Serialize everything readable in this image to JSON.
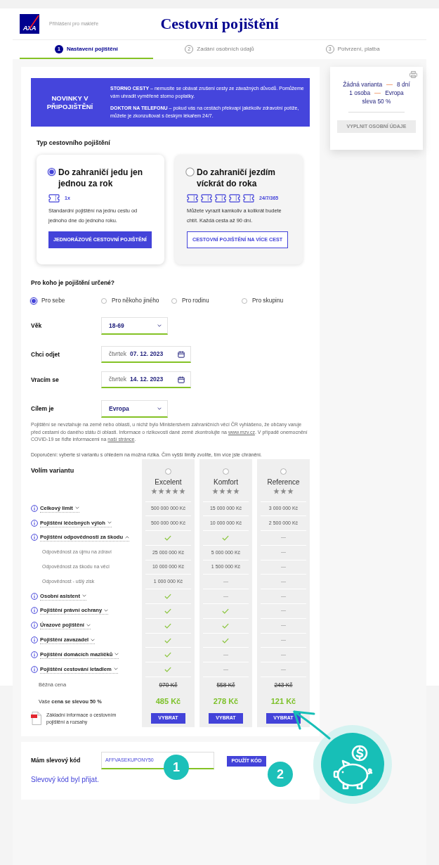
{
  "header": {
    "logo": "AXA",
    "broker_login": "Přihlášení pro makléře",
    "title": "Cestovní pojištění"
  },
  "steps": [
    {
      "number": "1",
      "label": "Nastavení pojištění",
      "selected": true
    },
    {
      "number": "2",
      "label": "Zadání osobních údajů",
      "selected": false
    },
    {
      "number": "3",
      "label": "Potvrzení, platba",
      "selected": false
    }
  ],
  "banner": {
    "heading": "NOVINKY V PŘIPOJIŠTĚNÍ",
    "paragraphs": [
      "**STORNO CESTY** – nemusíte se obávat zrušení cesty ze závažných důvodů. Pomůžeme vám uhradit vyměřené storno poplatky.",
      "**DOKTOR NA TELEFONU** – pokud vás na cestách překvapí jakékoliv zdravotní potíže, můžete je zkonzultovat s českým lékařem 24/7."
    ]
  },
  "insurance_type": {
    "title": "Typ cestovního pojištění",
    "options": [
      {
        "kind": "single",
        "title": "Do zahraničí jedu jen jednou za rok",
        "badge": "1x",
        "description": "Standardní pojištění na jednu cestu od jednoho dne do jednoho roku.",
        "button": "JEDNORÁZOVÉ CESTOVNÍ POJIŠTĚNÍ",
        "selected": true
      },
      {
        "kind": "multi",
        "title": "Do zahraničí jezdím víckrát do roka",
        "badge": "24/7/365",
        "description": "Můžete vyrazit kamkoliv a kolikrát budete chtít. Každá cesta až 90 dní.",
        "button": "CESTOVNÍ POJIŠTĚNÍ NA VÍCE CEST",
        "selected": false
      }
    ]
  },
  "recipient": {
    "title": "Pro koho je pojištění určené?",
    "options": [
      {
        "label": "Pro sebe",
        "selected": true
      },
      {
        "label": "Pro někoho jiného",
        "selected": false
      },
      {
        "label": "Pro rodinu",
        "selected": false
      },
      {
        "label": "Pro skupinu",
        "selected": false
      }
    ]
  },
  "form": [
    {
      "kind": "select",
      "label": "Věk",
      "value": "18-69"
    },
    {
      "kind": "date",
      "label": "Chci odjet",
      "weekday": "čtvrtek",
      "value": "07. 12. 2023"
    },
    {
      "kind": "date",
      "label": "Vracím se",
      "weekday": "čtvrtek",
      "value": "14. 12. 2023"
    },
    {
      "kind": "select",
      "label": "Cílem je",
      "value": "Evropa"
    }
  ],
  "notice": [
    {
      "kind": "text",
      "text": "Pojištění se nevztahuje na země nebo oblasti, u nichž bylo Ministerstvem zahraničních věcí ČR vyhlášeno, že občany varuje před cestami do daného státu či oblasti. Informace o rizikovosti dané země zkontrolujte na "
    },
    {
      "kind": "link",
      "text": "www.mzv.cz"
    },
    {
      "kind": "text",
      "text": ". V případě onemocnění COVID-19 se řiďte informacemi na "
    },
    {
      "kind": "link",
      "text": "naší stránce"
    },
    {
      "kind": "text",
      "text": "."
    }
  ],
  "recommendation": "Doporučení: vyberte si variantu s ohledem na možná rizika. Čím vyšší limity zvolíte, tím více jste chráněni.",
  "variants": {
    "title": "Volím variantu",
    "columns": [
      {
        "name": "Excelent",
        "stars": 5,
        "selected": false
      },
      {
        "name": "Komfort",
        "stars": 4,
        "selected": false
      },
      {
        "name": "Reference",
        "stars": 3,
        "selected": false
      }
    ],
    "rows": [
      {
        "label": "Celkový limit",
        "expanded": false,
        "cells": [
          {
            "kind": "amount",
            "text": "500 000 000 Kč"
          },
          {
            "kind": "amount",
            "text": "15 000 000 Kč"
          },
          {
            "kind": "amount",
            "text": "3 000 000 Kč"
          }
        ]
      },
      {
        "label": "Pojištění léčebných výloh",
        "expanded": false,
        "cells": [
          {
            "kind": "amount",
            "text": "500 000 000 Kč"
          },
          {
            "kind": "amount",
            "text": "10 000 000 Kč"
          },
          {
            "kind": "amount",
            "text": "2 500 000 Kč"
          }
        ]
      },
      {
        "label": "Pojištění odpovědnosti za škodu",
        "expanded": true,
        "cells": [
          {
            "kind": "included"
          },
          {
            "kind": "included"
          },
          {
            "kind": "excluded"
          }
        ],
        "children": [
          {
            "label": "Odpovědnost za újmu na zdraví",
            "cells": [
              {
                "kind": "amount",
                "text": "25 000 000 Kč"
              },
              {
                "kind": "amount",
                "text": "5 000 000 Kč"
              },
              {
                "kind": "excluded"
              }
            ]
          },
          {
            "label": "Odpovědnost za škodu na věci",
            "cells": [
              {
                "kind": "amount",
                "text": "10 000 000 Kč"
              },
              {
                "kind": "amount",
                "text": "1 500 000 Kč"
              },
              {
                "kind": "excluded"
              }
            ]
          },
          {
            "label": "Odpovědnost - ušlý zisk",
            "cells": [
              {
                "kind": "amount",
                "text": "1 000 000 Kč"
              },
              {
                "kind": "excluded"
              },
              {
                "kind": "excluded"
              }
            ]
          }
        ]
      },
      {
        "label": "Osobní asistent",
        "expanded": false,
        "cells": [
          {
            "kind": "included"
          },
          {
            "kind": "excluded"
          },
          {
            "kind": "excluded"
          }
        ]
      },
      {
        "label": "Pojištění právní ochrany",
        "expanded": false,
        "cells": [
          {
            "kind": "included"
          },
          {
            "kind": "included"
          },
          {
            "kind": "excluded"
          }
        ]
      },
      {
        "label": "Úrazové pojištění",
        "expanded": false,
        "cells": [
          {
            "kind": "included"
          },
          {
            "kind": "included"
          },
          {
            "kind": "excluded"
          }
        ]
      },
      {
        "label": "Pojištění zavazadel",
        "expanded": false,
        "cells": [
          {
            "kind": "included"
          },
          {
            "kind": "included"
          },
          {
            "kind": "excluded"
          }
        ]
      },
      {
        "label": "Pojištění domácích mazlíčků",
        "expanded": false,
        "cells": [
          {
            "kind": "included"
          },
          {
            "kind": "excluded"
          },
          {
            "kind": "excluded"
          }
        ]
      },
      {
        "label": "Pojištění cestování letadlem",
        "expanded": false,
        "cells": [
          {
            "kind": "included"
          },
          {
            "kind": "excluded"
          },
          {
            "kind": "excluded"
          }
        ]
      }
    ],
    "regular_price": {
      "label": "Běžná cena",
      "values": [
        "970 Kč",
        "558 Kč",
        "243 Kč"
      ]
    },
    "discount_price": {
      "label": "Vaše **cena se slevou 50 %**",
      "values": [
        "485 Kč",
        "278 Kč",
        "121 Kč"
      ]
    },
    "document_link": "Základní informace o cestovním pojištění a rozsahy",
    "buttons": [
      "VYBRAT",
      "VYBRAT",
      "VYBRAT"
    ]
  },
  "summary": {
    "lines": [
      [
        "Žádná varianta",
        "8 dní"
      ],
      [
        "1 osoba",
        "Evropa"
      ],
      [
        "sleva 50 %"
      ]
    ],
    "button": "VYPLNIT OSOBNÍ ÚDAJE",
    "button_disabled": true
  },
  "coupon": {
    "label": "Mám slevový kód",
    "value": "AFFVASEKUPONY50",
    "button": "POUŽÍT KÓD",
    "message": "Slevový kód byl přijat."
  },
  "annotations": [
    {
      "label": "1"
    },
    {
      "label": "2"
    }
  ]
}
